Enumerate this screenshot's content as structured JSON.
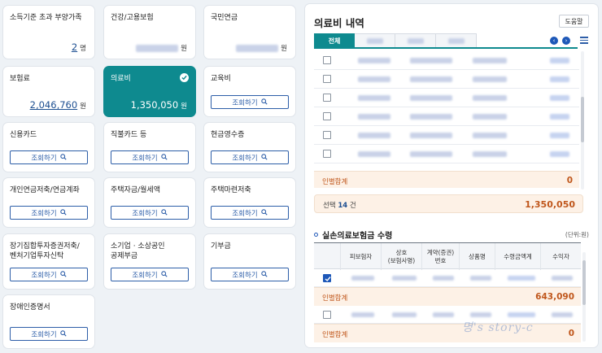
{
  "cards": [
    {
      "title": "소득기준 초과 부양가족",
      "value": "2",
      "unit": "명",
      "type": "value"
    },
    {
      "title": "건강/고용보험",
      "value": "",
      "unit": "원",
      "type": "blurred"
    },
    {
      "title": "국민연금",
      "value": "",
      "unit": "원",
      "type": "blurred"
    },
    {
      "title": "보험료",
      "value": "2,046,760",
      "unit": "원",
      "type": "value"
    },
    {
      "title": "의료비",
      "value": "1,350,050",
      "unit": "원",
      "type": "selected"
    },
    {
      "title": "교육비",
      "button": "조회하기",
      "type": "button"
    },
    {
      "title": "신용카드",
      "button": "조회하기",
      "type": "button"
    },
    {
      "title": "직불카드 등",
      "button": "조회하기",
      "type": "button"
    },
    {
      "title": "현금영수증",
      "button": "조회하기",
      "type": "button"
    },
    {
      "title": "개인연금저축/연금계좌",
      "button": "조회하기",
      "type": "button"
    },
    {
      "title": "주택자금/월세액",
      "button": "조회하기",
      "type": "button"
    },
    {
      "title": "주택마련저축",
      "button": "조회하기",
      "type": "button"
    },
    {
      "title": "장기집합투자증권저축/\n벤처기업투자신탁",
      "button": "조회하기",
      "type": "button"
    },
    {
      "title": "소기업 · 소상공인\n공제부금",
      "button": "조회하기",
      "type": "button"
    },
    {
      "title": "기부금",
      "button": "조회하기",
      "type": "button"
    },
    {
      "title": "장애인증명서",
      "button": "조회하기",
      "type": "button"
    }
  ],
  "panel": {
    "title": "의료비 내역",
    "help_label": "도움말",
    "tabs": [
      "전체",
      "",
      "",
      ""
    ],
    "list_rows": 6,
    "subtotal_label": "인별합계",
    "subtotal_value": "0",
    "selected_label": "선택",
    "selected_count": "14",
    "selected_unit": "건",
    "selected_total": "1,350,050",
    "section_title": "실손의료보험금 수령",
    "unit_note": "(단위:원)",
    "table_headers": [
      "피보험자",
      "상호\n(보험사명)",
      "계약(증권)\n번호",
      "상품명",
      "수령금액계",
      "수익자"
    ],
    "group1_checked": true,
    "group1_sum_label": "인별합계",
    "group1_sum_value": "643,090",
    "group2_checked": false,
    "group2_sum_label": "인별합계",
    "group2_sum_value": "0"
  },
  "watermark": "명's story-c",
  "colors": {
    "accent": "#0e8a8f",
    "link": "#1d4f91",
    "sum": "#c0571c",
    "button": "#2d5ea8"
  }
}
